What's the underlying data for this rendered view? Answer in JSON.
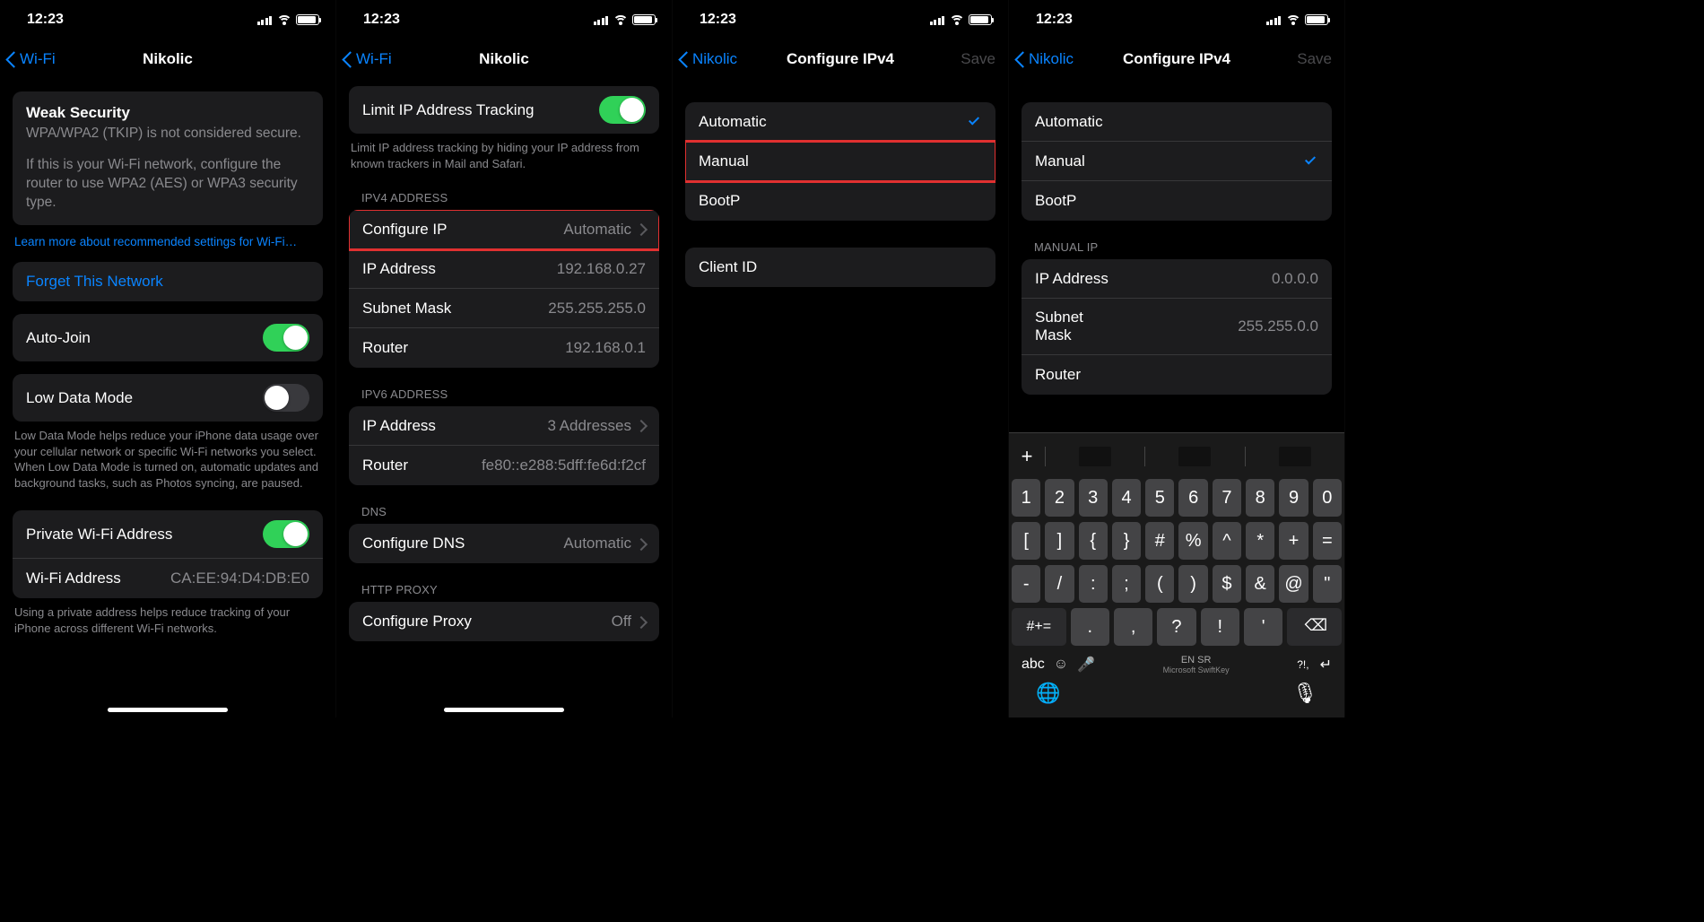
{
  "status": {
    "time": "12:23"
  },
  "common": {
    "save_label": "Save"
  },
  "screen1": {
    "back_label": "Wi-Fi",
    "title": "Nikolic",
    "weak_title": "Weak Security",
    "weak_body1": "WPA/WPA2 (TKIP) is not considered secure.",
    "weak_body2": "If this is your Wi-Fi network, configure the router to use WPA2 (AES) or WPA3 security type.",
    "learn_more": "Learn more about recommended settings for Wi-Fi…",
    "forget_label": "Forget This Network",
    "autojoin_label": "Auto-Join",
    "lowdata_label": "Low Data Mode",
    "lowdata_footer": "Low Data Mode helps reduce your iPhone data usage over your cellular network or specific Wi-Fi networks you select. When Low Data Mode is turned on, automatic updates and background tasks, such as Photos syncing, are paused.",
    "private_label": "Private Wi-Fi Address",
    "wifiaddr_label": "Wi-Fi Address",
    "wifiaddr_value": "CA:EE:94:D4:DB:E0",
    "private_footer": "Using a private address helps reduce tracking of your iPhone across different Wi-Fi networks."
  },
  "screen2": {
    "back_label": "Wi-Fi",
    "title": "Nikolic",
    "limit_label": "Limit IP Address Tracking",
    "limit_footer": "Limit IP address tracking by hiding your IP address from known trackers in Mail and Safari.",
    "ipv4_header": "IPV4 ADDRESS",
    "configip_label": "Configure IP",
    "configip_value": "Automatic",
    "ipaddr_label": "IP Address",
    "ipaddr_value": "192.168.0.27",
    "subnet_label": "Subnet Mask",
    "subnet_value": "255.255.255.0",
    "router_label": "Router",
    "router_value": "192.168.0.1",
    "ipv6_header": "IPV6 ADDRESS",
    "ipv6addr_label": "IP Address",
    "ipv6addr_value": "3 Addresses",
    "ipv6router_label": "Router",
    "ipv6router_value": "fe80::e288:5dff:fe6d:f2cf",
    "dns_header": "DNS",
    "configdns_label": "Configure DNS",
    "configdns_value": "Automatic",
    "proxy_header": "HTTP PROXY",
    "configproxy_label": "Configure Proxy",
    "configproxy_value": "Off"
  },
  "screen3": {
    "back_label": "Nikolic",
    "title": "Configure IPv4",
    "opts": {
      "automatic": "Automatic",
      "manual": "Manual",
      "bootp": "BootP"
    },
    "selected": "automatic",
    "clientid_label": "Client ID"
  },
  "screen4": {
    "back_label": "Nikolic",
    "title": "Configure IPv4",
    "opts": {
      "automatic": "Automatic",
      "manual": "Manual",
      "bootp": "BootP"
    },
    "selected": "manual",
    "manualip_header": "MANUAL IP",
    "ipaddr_label": "IP Address",
    "ipaddr_value": "0.0.0.0",
    "subnet_label": "Subnet Mask",
    "subnet_value": "255.255.0.0",
    "router_label": "Router"
  },
  "keyboard": {
    "rows": {
      "r1": [
        "1",
        "2",
        "3",
        "4",
        "5",
        "6",
        "7",
        "8",
        "9",
        "0"
      ],
      "r2": [
        "[",
        "]",
        "{",
        "}",
        "#",
        "%",
        "^",
        "*",
        "+",
        "="
      ],
      "r3": [
        "-",
        "/",
        ":",
        ";",
        "(",
        ")",
        "$",
        "&",
        "@",
        "\""
      ]
    },
    "shift_label": "#+=",
    "r4": [
      ".",
      ",",
      "?",
      "!",
      "'"
    ],
    "abc_label": "abc",
    "lang": "EN SR",
    "brand": "Microsoft SwiftKey",
    "qmark": "?!,"
  }
}
